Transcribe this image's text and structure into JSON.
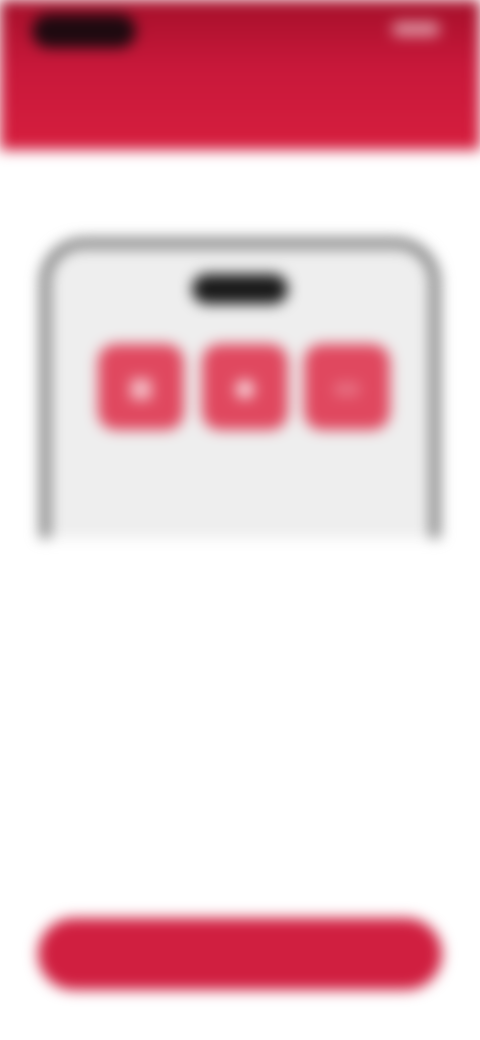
{
  "header": {
    "title": ""
  },
  "steps": [
    {
      "label": ""
    },
    {
      "label": ""
    }
  ],
  "phone": {
    "apps": [
      {
        "icon": "grid-icon",
        "glyph": "▦",
        "label": ""
      },
      {
        "icon": "camera-icon",
        "glyph": "◉",
        "label": ""
      },
      {
        "icon": "message-icon",
        "glyph": "▭",
        "label": ""
      }
    ]
  },
  "content": {
    "paragraphs": [
      {
        "text": ""
      },
      {
        "text": ""
      },
      {
        "text": ""
      },
      {
        "text": ""
      },
      {
        "text": ""
      }
    ]
  },
  "cta": {
    "label": ""
  },
  "colors": {
    "brand": "#d01f40",
    "header_dark": "#a50f2a",
    "app_tile": "#e0485f"
  }
}
